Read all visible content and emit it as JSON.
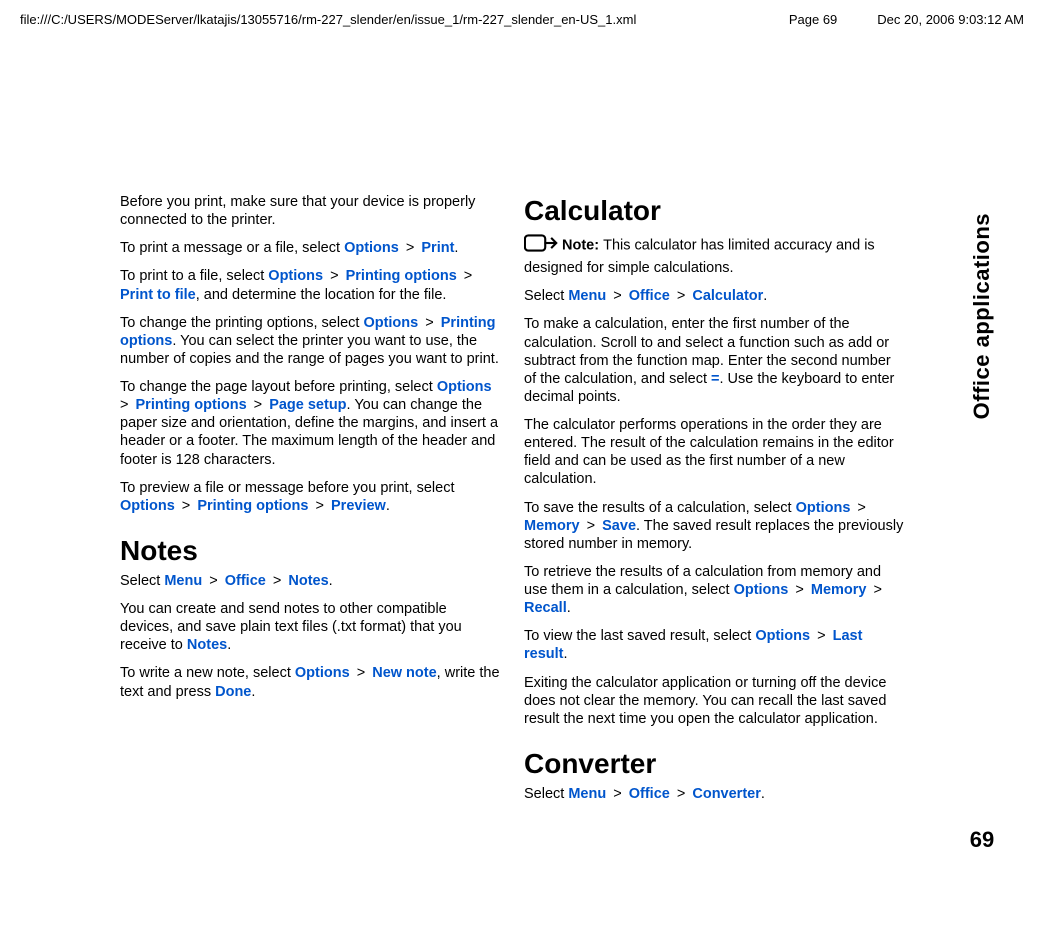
{
  "header": {
    "path": "file:///C:/USERS/MODEServer/lkatajis/13055716/rm-227_slender/en/issue_1/rm-227_slender_en-US_1.xml",
    "page": "Page 69",
    "date": "Dec 20, 2006 9:03:12 AM"
  },
  "sidebar": {
    "title": "Office applications",
    "pageno": "69"
  },
  "col1": {
    "p1": "Before you print, make sure that your device is properly connected to the printer.",
    "p2a": "To print a message or a file, select ",
    "p2_opt": "Options",
    "p2_print": "Print",
    "p2b": ".",
    "p3a": "To print to a file, select ",
    "p3_opt": "Options",
    "p3_po": "Printing options",
    "p3_ptf": "Print to file",
    "p3b": ", and determine the location for the file.",
    "p4a": "To change the printing options, select ",
    "p4_opt": "Options",
    "p4_po": "Printing options",
    "p4b": ". You can select the printer you want to use, the number of copies and the range of pages you want to print.",
    "p5a": "To change the page layout before printing, select ",
    "p5_opt": "Options",
    "p5_po": "Printing options",
    "p5_ps": "Page setup",
    "p5b": ". You can change the paper size and orientation, define the margins, and insert a header or a footer. The maximum length of the header and footer is 128 characters.",
    "p6a": "To preview a file or message before you print, select ",
    "p6_opt": "Options",
    "p6_po": "Printing options",
    "p6_prev": "Preview",
    "p6b": ".",
    "h_notes": "Notes",
    "p7a": "Select ",
    "p7_menu": "Menu",
    "p7_office": "Office",
    "p7_notes": "Notes",
    "p7b": ".",
    "p8a": "You can create and send notes to other compatible devices, and save plain text files (.txt format) that you receive to ",
    "p8_notes": "Notes",
    "p8b": ".",
    "p9a": "To write a new note, select ",
    "p9_opt": "Options",
    "p9_nn": "New note",
    "p9b": ", write the text and press ",
    "p9_done": "Done",
    "p9c": "."
  },
  "col2": {
    "h_calc": "Calculator",
    "note_label": "Note:  ",
    "note_text": "This calculator has limited accuracy and is designed for simple calculations.",
    "p1a": "Select ",
    "p1_menu": "Menu",
    "p1_office": "Office",
    "p1_calc": "Calculator",
    "p1b": ".",
    "p2a": "To make a calculation, enter the first number of the calculation. Scroll to and select a function such as add or subtract from the function map. Enter the second number of the calculation, and select ",
    "p2_eq": "=",
    "p2b": ". Use the keyboard to enter decimal points.",
    "p3": "The calculator performs operations in the order they are entered. The result of the calculation remains in the editor field and can be used as the first number of a new calculation.",
    "p4a": "To save the results of a calculation, select ",
    "p4_opt": "Options",
    "p4_mem": "Memory",
    "p4_save": "Save",
    "p4b": ". The saved result replaces the previously stored number in memory.",
    "p5a": "To retrieve the results of a calculation from memory and use them in a calculation, select ",
    "p5_opt": "Options",
    "p5_mem": "Memory",
    "p5_recall": "Recall",
    "p5b": ".",
    "p6a": "To view the last saved result, select ",
    "p6_opt": "Options",
    "p6_lr": "Last result",
    "p6b": ".",
    "p7": "Exiting the calculator application or turning off the device does not clear the memory. You can recall the last saved result the next time you open the calculator application.",
    "h_conv": "Converter",
    "p8a": "Select ",
    "p8_menu": "Menu",
    "p8_office": "Office",
    "p8_conv": "Converter",
    "p8b": "."
  }
}
